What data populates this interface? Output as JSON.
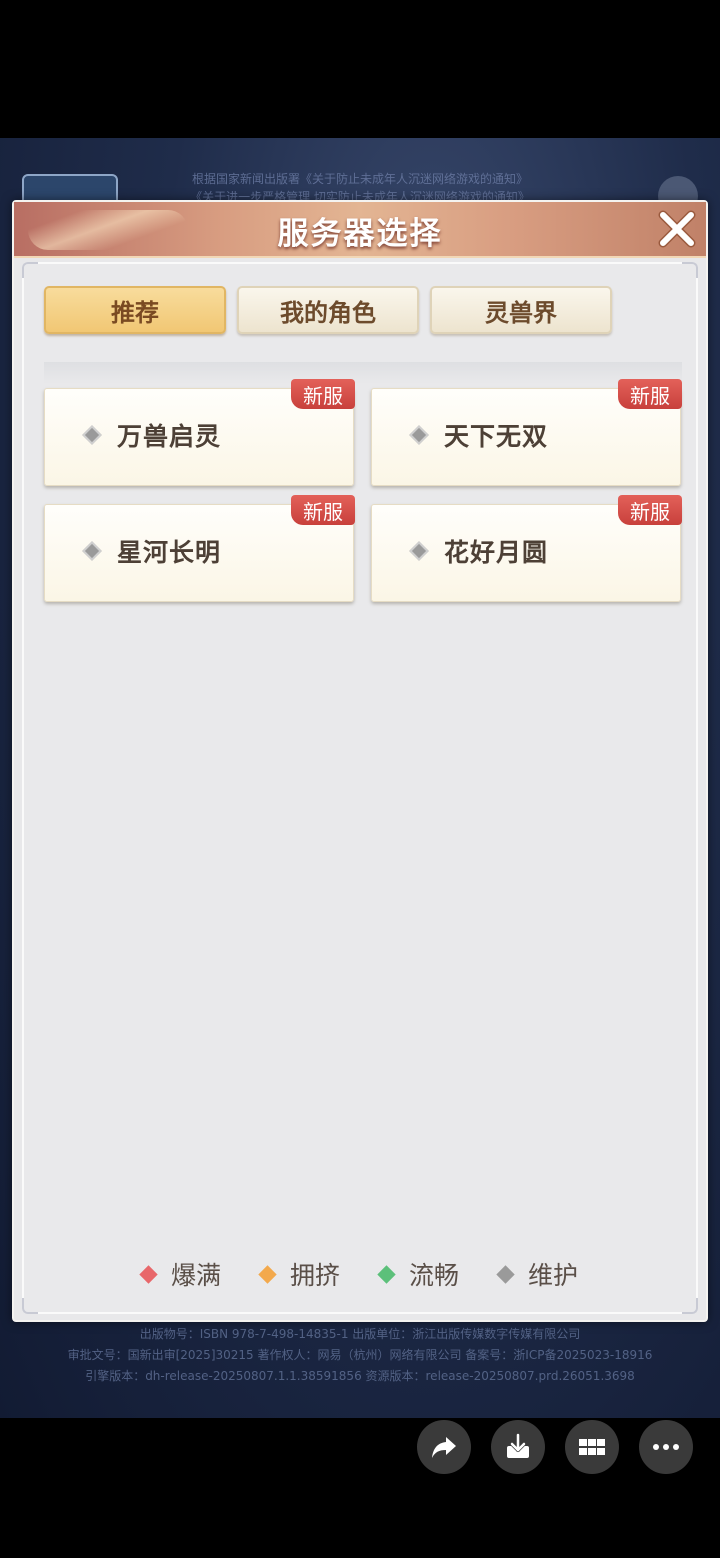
{
  "background": {
    "notice_line1": "根据国家新闻出版署《关于防止未成年人沉迷网络游戏的通知》",
    "notice_line2": "《关于进一步严格管理 切实防止未成年人沉迷网络游戏的通知》",
    "footer_line1": "出版物号：ISBN 978-7-498-14835-1    出版单位：浙江出版传媒数字传媒有限公司",
    "footer_line2": "审批文号：国新出审[2025]30215    著作权人：网易（杭州）网络有限公司    备案号：浙ICP备2025023-18916",
    "footer_line3": "引擎版本：dh-release-20250807.1.1.38591856    资源版本：release-20250807.prd.26051.3698"
  },
  "dialog": {
    "title": "服务器选择",
    "close_icon": "close-icon"
  },
  "tabs": [
    {
      "label": "推荐",
      "active": true
    },
    {
      "label": "我的角色",
      "active": false
    },
    {
      "label": "灵兽界",
      "active": false
    }
  ],
  "servers": [
    {
      "name": "万兽启灵",
      "badge": "新服",
      "status": "maintenance"
    },
    {
      "name": "天下无双",
      "badge": "新服",
      "status": "maintenance"
    },
    {
      "name": "星河长明",
      "badge": "新服",
      "status": "maintenance"
    },
    {
      "name": "花好月圆",
      "badge": "新服",
      "status": "maintenance"
    }
  ],
  "legend": [
    {
      "label": "爆满",
      "color": "#e8676a"
    },
    {
      "label": "拥挤",
      "color": "#f3a94c"
    },
    {
      "label": "流畅",
      "color": "#5cc07a"
    },
    {
      "label": "维护",
      "color": "#9a9a9a"
    }
  ],
  "actions": [
    {
      "icon": "share-icon"
    },
    {
      "icon": "download-icon"
    },
    {
      "icon": "grid-icon"
    },
    {
      "icon": "more-icon"
    }
  ]
}
